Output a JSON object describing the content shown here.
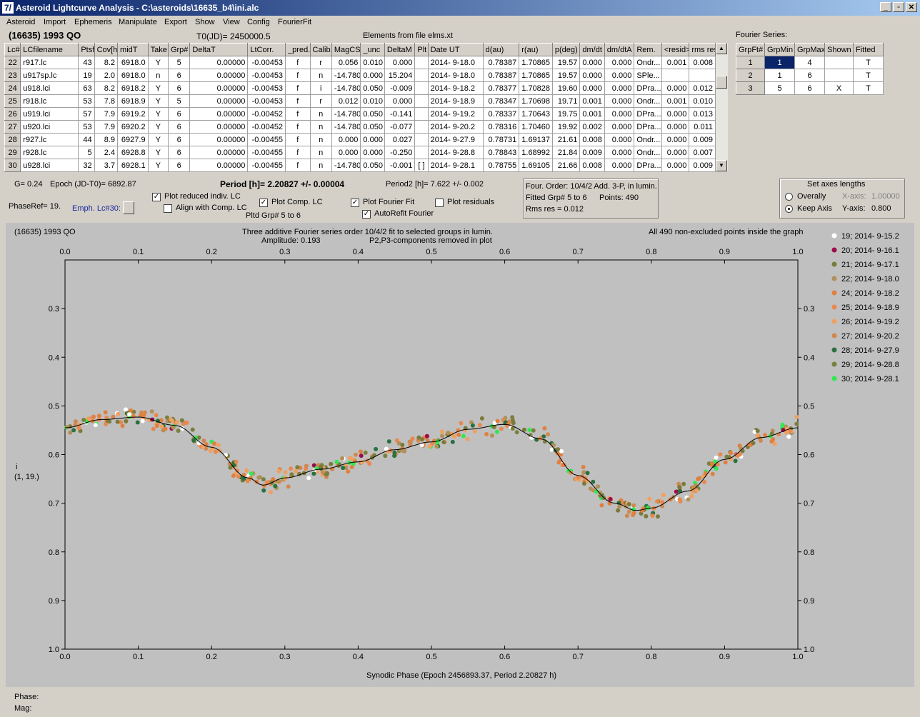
{
  "window": {
    "title": "Asteroid Lightcurve Analysis - C:\\asteroids\\16635_b4\\ini.alc",
    "app_icon": "7/"
  },
  "menu": [
    "Asteroid",
    "Import",
    "Ephemeris",
    "Manipulate",
    "Export",
    "Show",
    "View",
    "Config",
    "FourierFit"
  ],
  "header": {
    "asteroid": "(16635) 1993 QO",
    "t0": "T0(JD)= 2450000.5",
    "elements": "Elements from file elms.xt"
  },
  "table": {
    "columns": [
      "Lc#",
      "LCfilename",
      "Ptsf",
      "Cov[h]",
      "midT",
      "Take",
      "Grp#",
      "DeltaT",
      "LtCorr.",
      "_pred.",
      "Calib.",
      "MagCS",
      "_unc",
      "DeltaM",
      "Plt",
      "Date UT",
      "d(au)",
      "r(au)",
      "p(deg)",
      "dm/dt",
      "dm/dtA",
      "Rem.",
      "<resid>",
      "rms res"
    ],
    "rows": [
      [
        "22",
        "r917.lc",
        "43",
        "8.2",
        "6918.0",
        "Y",
        "5",
        "0.00000",
        "-0.00453",
        "f",
        "r",
        "0.056",
        "0.010",
        "0.000",
        "",
        "2014- 9-18.0",
        "0.78387",
        "1.70865",
        "19.57",
        "0.000",
        "0.000",
        "Ondr...",
        "0.001",
        "0.008"
      ],
      [
        "23",
        "u917sp.lc",
        "19",
        "2.0",
        "6918.0",
        "n",
        "6",
        "0.00000",
        "-0.00453",
        "f",
        "n",
        "-14.780",
        "0.000",
        "15.204",
        "",
        "2014- 9-18.0",
        "0.78387",
        "1.70865",
        "19.57",
        "0.000",
        "0.000",
        "SPle...",
        "",
        ""
      ],
      [
        "24",
        "u918.lci",
        "63",
        "8.2",
        "6918.2",
        "Y",
        "6",
        "0.00000",
        "-0.00453",
        "f",
        "i",
        "-14.780",
        "0.050",
        "-0.009",
        "",
        "2014- 9-18.2",
        "0.78377",
        "1.70828",
        "19.60",
        "0.000",
        "0.000",
        "DPra...",
        "0.000",
        "0.012"
      ],
      [
        "25",
        "r918.lc",
        "53",
        "7.8",
        "6918.9",
        "Y",
        "5",
        "0.00000",
        "-0.00453",
        "f",
        "r",
        "0.012",
        "0.010",
        "0.000",
        "",
        "2014- 9-18.9",
        "0.78347",
        "1.70698",
        "19.71",
        "0.001",
        "0.000",
        "Ondr...",
        "0.001",
        "0.010"
      ],
      [
        "26",
        "u919.lci",
        "57",
        "7.9",
        "6919.2",
        "Y",
        "6",
        "0.00000",
        "-0.00452",
        "f",
        "n",
        "-14.780",
        "0.050",
        "-0.141",
        "",
        "2014- 9-19.2",
        "0.78337",
        "1.70643",
        "19.75",
        "0.001",
        "0.000",
        "DPra...",
        "0.000",
        "0.013"
      ],
      [
        "27",
        "u920.lci",
        "53",
        "7.9",
        "6920.2",
        "Y",
        "6",
        "0.00000",
        "-0.00452",
        "f",
        "n",
        "-14.780",
        "0.050",
        "-0.077",
        "",
        "2014- 9-20.2",
        "0.78316",
        "1.70460",
        "19.92",
        "0.002",
        "0.000",
        "DPra...",
        "0.000",
        "0.011"
      ],
      [
        "28",
        "r927.lc",
        "44",
        "8.9",
        "6927.9",
        "Y",
        "6",
        "0.00000",
        "-0.00455",
        "f",
        "n",
        "0.000",
        "0.000",
        "0.027",
        "",
        "2014- 9-27.9",
        "0.78731",
        "1.69137",
        "21.61",
        "0.008",
        "0.000",
        "Ondr...",
        "0.000",
        "0.009"
      ],
      [
        "29",
        "r928.lc",
        "5",
        "2.4",
        "6928.8",
        "Y",
        "6",
        "0.00000",
        "-0.00455",
        "f",
        "n",
        "0.000",
        "0.000",
        "-0.250",
        "",
        "2014- 9-28.8",
        "0.78843",
        "1.68992",
        "21.84",
        "0.009",
        "0.000",
        "Ondr...",
        "0.000",
        "0.007"
      ],
      [
        "30",
        "u928.lci",
        "32",
        "3.7",
        "6928.1",
        "Y",
        "6",
        "0.00000",
        "-0.00455",
        "f",
        "n",
        "-14.780",
        "0.050",
        "-0.001",
        "[ ]",
        "2014- 9-28.1",
        "0.78755",
        "1.69105",
        "21.66",
        "0.008",
        "0.000",
        "DPra...",
        "0.000",
        "0.009"
      ]
    ]
  },
  "fourier_series": {
    "label": "Fourier Series:",
    "columns": [
      "GrpFt#",
      "GrpMin",
      "GrpMax",
      "Shown",
      "Fitted"
    ],
    "rows": [
      [
        "1",
        "1",
        "4",
        "",
        "T"
      ],
      [
        "2",
        "1",
        "6",
        "",
        "T"
      ],
      [
        "3",
        "5",
        "6",
        "X",
        "T"
      ]
    ]
  },
  "controls": {
    "g": "G= 0.24",
    "epoch": "Epoch (JD-T0)= 6892.87",
    "period": "Period [h]= 2.20827 +/- 0.00004",
    "period2": "Period2 [h]= 7.622 +/- 0.002",
    "phaseref": "PhaseRef= 19.",
    "emph": "Emph. Lc#30:",
    "plot_reduced": "Plot reduced indiv. LC",
    "align_comp": "Align with Comp. LC",
    "plot_comp": "Plot Comp. LC",
    "pltd_grp": "Pltd Grp#  5  to   6",
    "plot_fourier": "Plot Fourier Fit",
    "autorefit": "AutoRefit Fourier",
    "plot_residuals": "Plot residuals",
    "four_order": "Four. Order: 10/4/2  Add. 3-P, in lumin.",
    "fitted_grp": "Fitted Grp# 5 to 6",
    "points": "Points: 490",
    "rms": "Rms res     = 0.012",
    "axes_title": "Set axes lengths",
    "overally": "Overally",
    "keep_axis": "Keep Axis",
    "xaxis_label": "X-axis:",
    "xaxis_value": "1.00000",
    "yaxis_label": "Y-axis:",
    "yaxis_value": "0.800"
  },
  "plot": {
    "top_left": "(16635) 1993 QO",
    "title1": "Three additive Fourier series order 10/4/2 fit to selected groups in lumin.",
    "amplitude": "Amplitude: 0.193",
    "title2": "P2,P3-components removed in plot",
    "top_right": "All 490 non-excluded points inside the graph",
    "ylabel1": "i",
    "ylabel2": "(1, 19.)",
    "xlabel": "Synodic Phase (Epoch 2456893.37, Period 2.20827 h)"
  },
  "chart_data": {
    "type": "scatter",
    "xlabel": "Synodic Phase (Epoch 2456893.37, Period 2.20827 h)",
    "ylabel": "i",
    "xlim": [
      0.0,
      1.0
    ],
    "ylim": [
      0.2,
      1.0
    ],
    "y_inverted": true,
    "x_ticks": [
      "0.0",
      "0.1",
      "0.2",
      "0.3",
      "0.4",
      "0.5",
      "0.6",
      "0.7",
      "0.8",
      "0.9",
      "1.0"
    ],
    "y_ticks": [
      "0.3",
      "0.4",
      "0.5",
      "0.6",
      "0.7",
      "0.8",
      "0.9",
      "1.0"
    ],
    "legend": [
      {
        "name": "19; 2014- 9-15.2",
        "color": "#ffffff"
      },
      {
        "name": "20; 2014- 9-16.1",
        "color": "#9b0a4a"
      },
      {
        "name": "21; 2014- 9-17.1",
        "color": "#7a7a3a"
      },
      {
        "name": "22; 2014- 9-18.0",
        "color": "#b0905a"
      },
      {
        "name": "24; 2014- 9-18.2",
        "color": "#e08040"
      },
      {
        "name": "25; 2014- 9-18.9",
        "color": "#e88850"
      },
      {
        "name": "26; 2014- 9-19.2",
        "color": "#f0a060"
      },
      {
        "name": "27; 2014- 9-20.2",
        "color": "#d08850"
      },
      {
        "name": "28; 2014- 9-27.9",
        "color": "#2a7040"
      },
      {
        "name": "29; 2014- 9-28.8",
        "color": "#7a8040"
      },
      {
        "name": "30; 2014- 9-28.1",
        "color": "#30e850"
      }
    ],
    "fit_curve": {
      "x": [
        0.0,
        0.05,
        0.1,
        0.15,
        0.2,
        0.25,
        0.27,
        0.3,
        0.35,
        0.4,
        0.45,
        0.5,
        0.55,
        0.6,
        0.65,
        0.7,
        0.75,
        0.78,
        0.8,
        0.85,
        0.9,
        0.95,
        1.0
      ],
      "y": [
        0.545,
        0.528,
        0.523,
        0.54,
        0.585,
        0.648,
        0.663,
        0.648,
        0.63,
        0.615,
        0.59,
        0.574,
        0.548,
        0.538,
        0.568,
        0.643,
        0.7,
        0.715,
        0.71,
        0.675,
        0.61,
        0.565,
        0.545
      ]
    }
  }
}
